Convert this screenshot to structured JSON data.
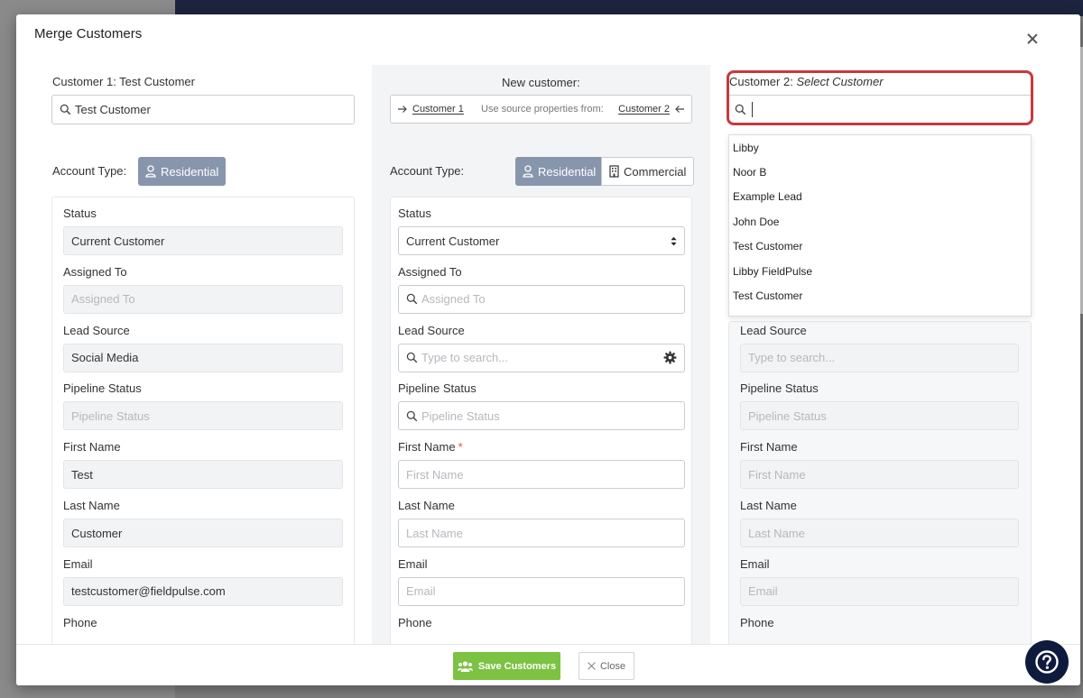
{
  "modal": {
    "title": "Merge Customers"
  },
  "customer1": {
    "label": "Customer 1: Test Customer",
    "search_value": "Test Customer",
    "account_type_label": "Account Type:",
    "account_type": "Residential",
    "fields": [
      {
        "label": "Status",
        "value": "Current Customer",
        "placeholder": ""
      },
      {
        "label": "Assigned To",
        "value": "",
        "placeholder": "Assigned To"
      },
      {
        "label": "Lead Source",
        "value": "Social Media",
        "placeholder": ""
      },
      {
        "label": "Pipeline Status",
        "value": "",
        "placeholder": "Pipeline Status"
      },
      {
        "label": "First Name",
        "value": "Test",
        "placeholder": ""
      },
      {
        "label": "Last Name",
        "value": "Customer",
        "placeholder": ""
      },
      {
        "label": "Email",
        "value": "testcustomer@fieldpulse.com",
        "placeholder": ""
      },
      {
        "label": "Phone",
        "value": "",
        "placeholder": ""
      }
    ]
  },
  "new_customer": {
    "title": "New customer:",
    "source": {
      "left": "Customer 1",
      "middle": "Use source properties from:",
      "right": "Customer 2"
    },
    "account_type_label": "Account Type:",
    "account_types": [
      "Residential",
      "Commercial"
    ],
    "fields": [
      {
        "label": "Status",
        "value": "Current Customer",
        "placeholder": ""
      },
      {
        "label": "Assigned To",
        "value": "",
        "placeholder": "Assigned To"
      },
      {
        "label": "Lead Source",
        "value": "",
        "placeholder": "Type to search..."
      },
      {
        "label": "Pipeline Status",
        "value": "",
        "placeholder": "Pipeline Status"
      },
      {
        "label": "First Name",
        "value": "",
        "placeholder": "First Name"
      },
      {
        "label": "Last Name",
        "value": "",
        "placeholder": "Last Name"
      },
      {
        "label": "Email",
        "value": "",
        "placeholder": "Email"
      },
      {
        "label": "Phone",
        "value": "",
        "placeholder": ""
      }
    ]
  },
  "customer2": {
    "label_prefix": "Customer 2:",
    "label_value": "Select Customer",
    "search_value": "",
    "dropdown": [
      "Libby",
      "Noor B",
      "Example Lead",
      "John Doe",
      "Test Customer",
      "Libby FieldPulse",
      "Test Customer"
    ],
    "fields": [
      {
        "label": "Lead Source",
        "placeholder": "Type to search..."
      },
      {
        "label": "Pipeline Status",
        "placeholder": "Pipeline Status"
      },
      {
        "label": "First Name",
        "placeholder": "First Name"
      },
      {
        "label": "Last Name",
        "placeholder": "Last Name"
      },
      {
        "label": "Email",
        "placeholder": "Email"
      },
      {
        "label": "Phone",
        "placeholder": ""
      }
    ]
  },
  "footer": {
    "save_label": "Save Customers",
    "close_label": "Close"
  },
  "colors": {
    "accent_green": "#7cc243",
    "residential_active": "#8896ad",
    "highlight_red": "#c9393d",
    "help_navy": "#0f1b3d"
  },
  "icons": {
    "search": "search-icon",
    "gear": "gear-icon",
    "user": "user-icon",
    "building": "building-icon",
    "users": "users-icon",
    "help": "help-icon"
  }
}
